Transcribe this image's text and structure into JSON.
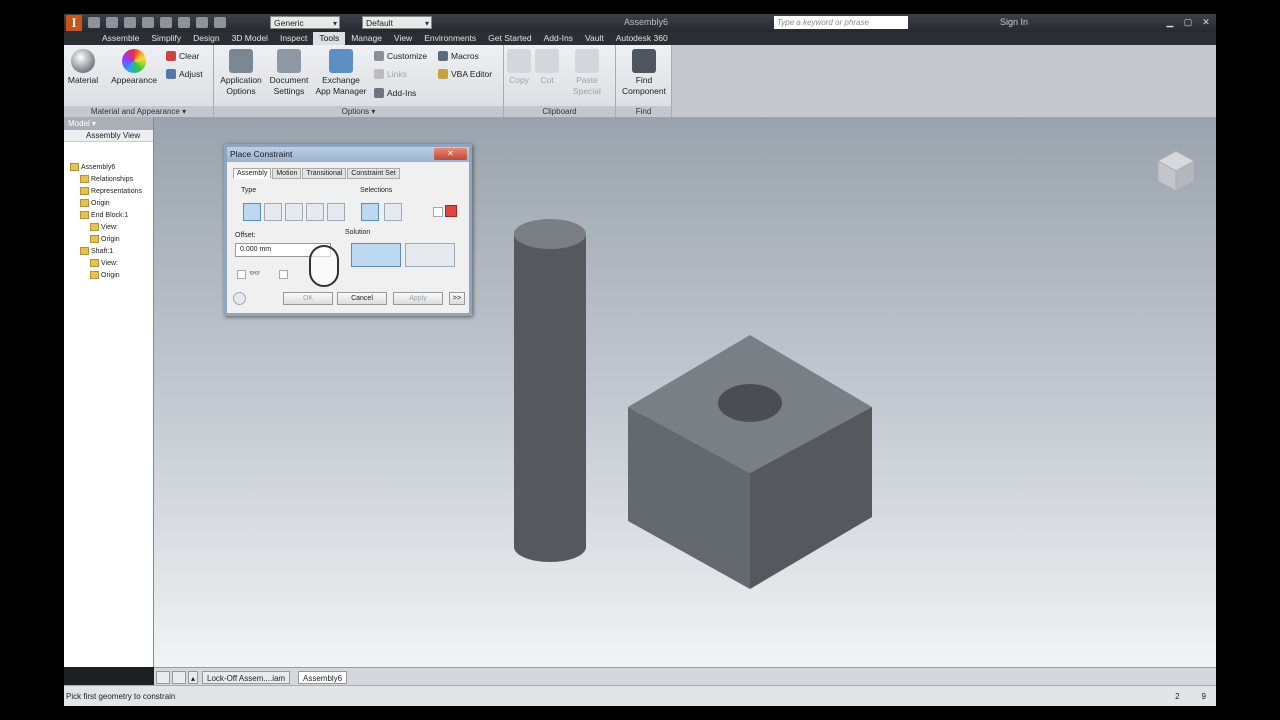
{
  "titlebar": {
    "appearance_select": "Generic",
    "style_select": "Default",
    "document_title": "Assembly6",
    "search_placeholder": "Type a keyword or phrase",
    "sign_in": "Sign In"
  },
  "menu_tabs": [
    "Assemble",
    "Simplify",
    "Design",
    "3D Model",
    "Inspect",
    "Tools",
    "Manage",
    "View",
    "Environments",
    "Get Started",
    "Add-Ins",
    "Vault",
    "Autodesk 360"
  ],
  "active_tab": "Tools",
  "ribbon": {
    "material": "Material",
    "appearance": "Appearance",
    "clear": "Clear",
    "adjust": "Adjust",
    "material_panel_title": "Material and Appearance ▾",
    "application_options_1": "Application",
    "application_options_2": "Options",
    "document_settings_1": "Document",
    "document_settings_2": "Settings",
    "exchange_1": "Exchange",
    "exchange_2": "App Manager",
    "customize": "Customize",
    "links": "Links",
    "add_ins": "Add-Ins",
    "macros": "Macros",
    "vba_editor": "VBA Editor",
    "options_panel_title": "Options ▾",
    "copy": "Copy",
    "cut": "Cut",
    "paste_special_1": "Paste",
    "paste_special_2": "Special",
    "clipboard_panel_title": "Clipboard",
    "find_component_1": "Find",
    "find_component_2": "Component",
    "find_panel_title": "Find"
  },
  "browser": {
    "header": "Model ▾",
    "view_label": "Assembly View",
    "tree": [
      {
        "label": "Assembly6",
        "level": 0
      },
      {
        "label": "Relationships",
        "level": 1
      },
      {
        "label": "Representations",
        "level": 1
      },
      {
        "label": "Origin",
        "level": 1
      },
      {
        "label": "End Block:1",
        "level": 1
      },
      {
        "label": "View:",
        "level": 2
      },
      {
        "label": "Origin",
        "level": 2
      },
      {
        "label": "Shaft:1",
        "level": 1
      },
      {
        "label": "View:",
        "level": 2
      },
      {
        "label": "Origin",
        "level": 2
      }
    ]
  },
  "dialog": {
    "title": "Place Constraint",
    "tabs": [
      "Assembly",
      "Motion",
      "Transitional",
      "Constraint Set"
    ],
    "type_label": "Type",
    "selections_label": "Selections",
    "offset_label": "Offset:",
    "offset_value": "0.000 mm",
    "solution_label": "Solution",
    "ok": "OK",
    "cancel": "Cancel",
    "apply": "Apply",
    "more": ">>"
  },
  "doc_tabs": [
    "Lock-Off Assem....iam",
    "Assembly6"
  ],
  "status": {
    "message": "Pick first geometry to constrain",
    "count1": "2",
    "count2": "9"
  }
}
